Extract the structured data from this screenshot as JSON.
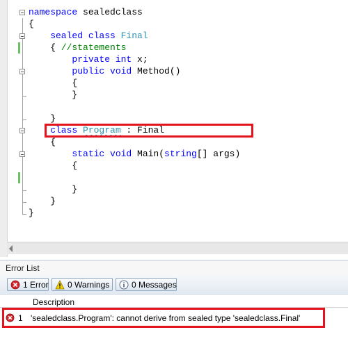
{
  "editor": {
    "lines": [
      [
        {
          "t": "namespace ",
          "c": "kw"
        },
        {
          "t": "sealedclass",
          "c": ""
        }
      ],
      [
        {
          "t": "{",
          "c": ""
        }
      ],
      [
        {
          "t": "    sealed class ",
          "c": "kw"
        },
        {
          "t": "Final",
          "c": "type"
        }
      ],
      [
        {
          "t": "    { ",
          "c": ""
        },
        {
          "t": "//statements",
          "c": "cm"
        }
      ],
      [
        {
          "t": "        private int ",
          "c": "kw"
        },
        {
          "t": "x;",
          "c": ""
        }
      ],
      [
        {
          "t": "        public void ",
          "c": "kw"
        },
        {
          "t": "Method()",
          "c": ""
        }
      ],
      [
        {
          "t": "        {",
          "c": ""
        }
      ],
      [
        {
          "t": "        }",
          "c": ""
        }
      ],
      [
        {
          "t": "",
          "c": ""
        }
      ],
      [
        {
          "t": "    }",
          "c": ""
        }
      ],
      [
        {
          "t": "    class ",
          "c": "kw"
        },
        {
          "t": "Program",
          "c": "type squiggle"
        },
        {
          "t": " : Final",
          "c": ""
        }
      ],
      [
        {
          "t": "    {",
          "c": ""
        }
      ],
      [
        {
          "t": "        static void ",
          "c": "kw"
        },
        {
          "t": "Main(",
          "c": ""
        },
        {
          "t": "string",
          "c": "kw"
        },
        {
          "t": "[] args)",
          "c": ""
        }
      ],
      [
        {
          "t": "        {",
          "c": ""
        }
      ],
      [
        {
          "t": "",
          "c": ""
        }
      ],
      [
        {
          "t": "        }",
          "c": ""
        }
      ],
      [
        {
          "t": "    }",
          "c": ""
        }
      ],
      [
        {
          "t": "}",
          "c": ""
        }
      ]
    ]
  },
  "error_list": {
    "title": "Error List",
    "buttons": {
      "errors": "1 Error",
      "warnings": "0 Warnings",
      "messages": "0 Messages"
    },
    "column_description": "Description",
    "rows": [
      {
        "number": "1",
        "description": "'sealedclass.Program': cannot derive from sealed type 'sealedclass.Final'"
      }
    ]
  },
  "colors": {
    "highlight_box": "#e3141d",
    "keyword": "#0000ff",
    "type": "#2b91af",
    "comment": "#008000",
    "error_icon": "#d0272d"
  }
}
